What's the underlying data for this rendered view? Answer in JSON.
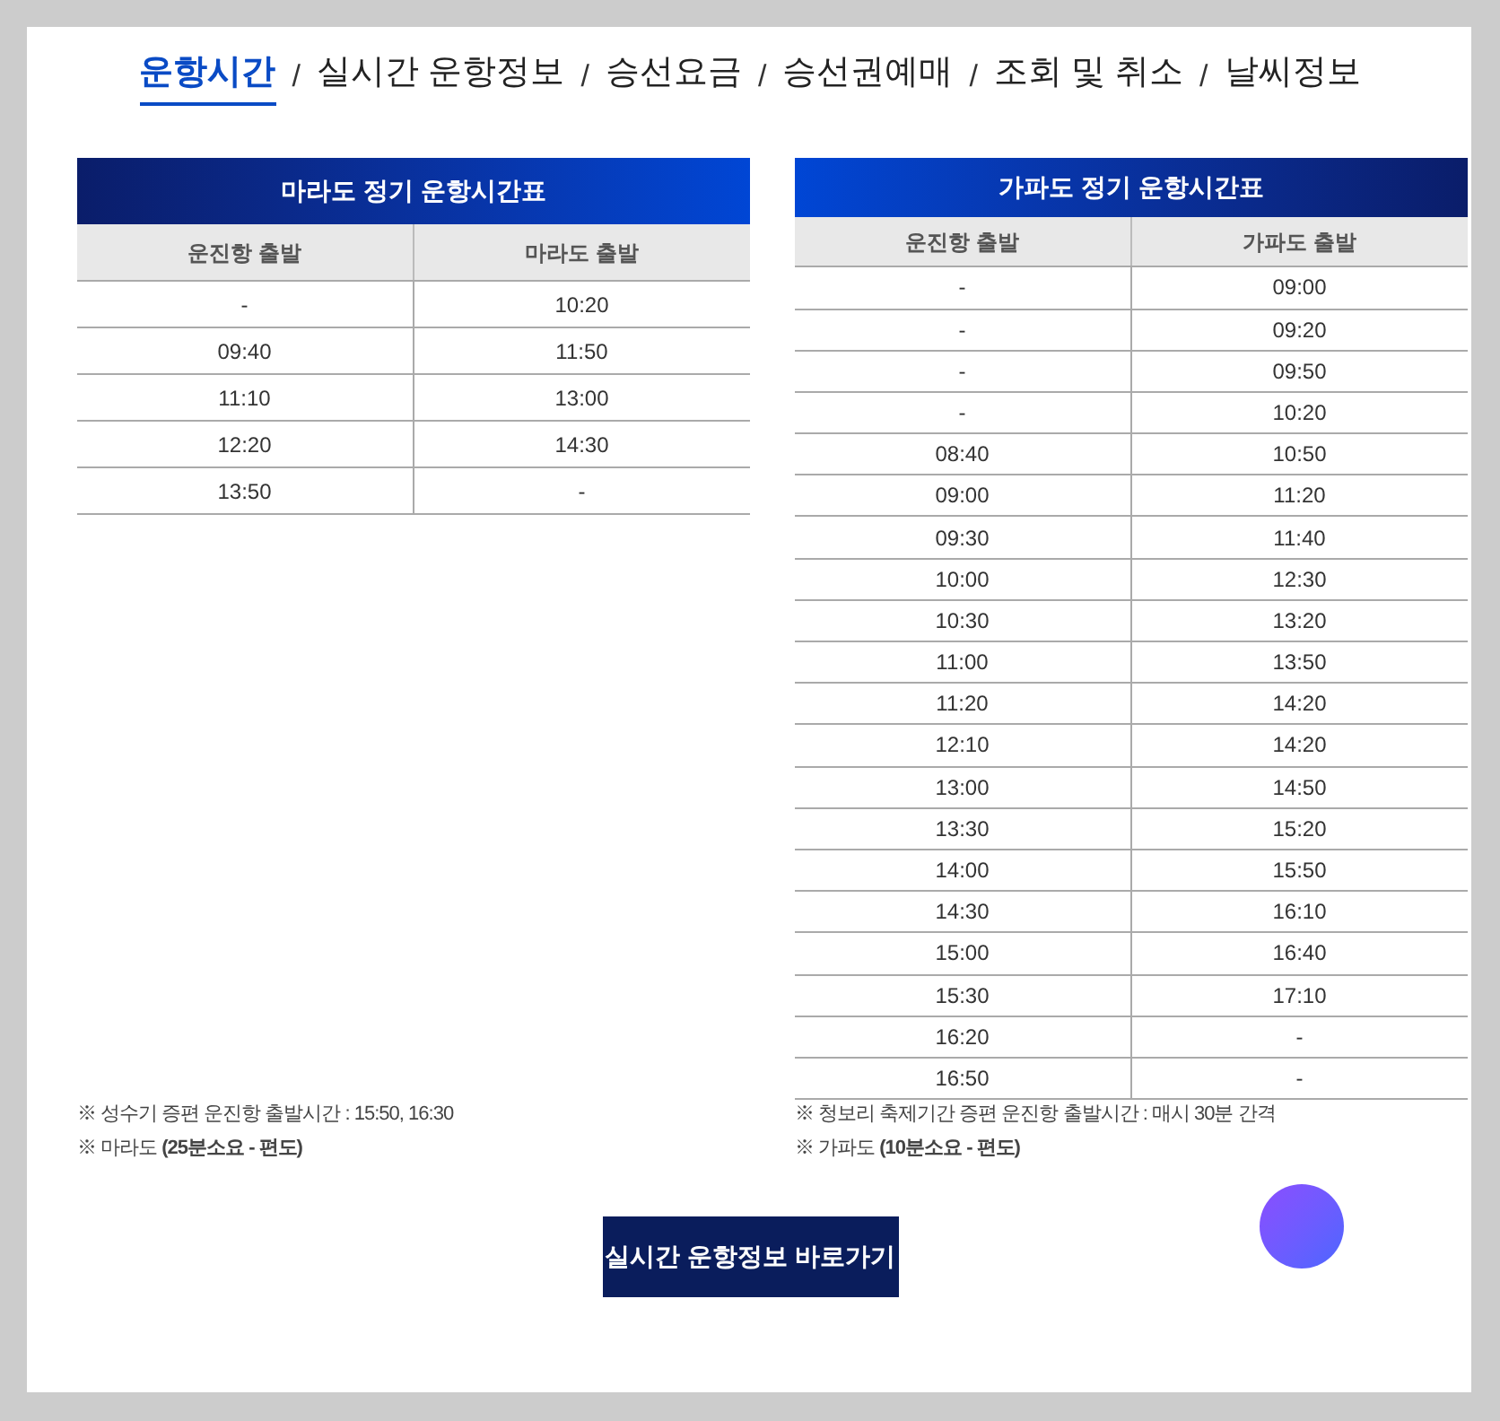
{
  "nav": [
    {
      "label": "운항시간",
      "selected": true
    },
    {
      "label": "실시간 운항정보",
      "selected": false
    },
    {
      "label": "승선요금",
      "selected": false
    },
    {
      "label": "승선권예매",
      "selected": false
    },
    {
      "label": "조회 및 취소",
      "selected": false
    },
    {
      "label": "날씨정보",
      "selected": false
    }
  ],
  "nav_separator": "/",
  "tables": [
    {
      "title": "마라도 정기 운항시간표",
      "columns": [
        "운진항 출발",
        "마라도 출발"
      ],
      "rows": [
        [
          "-",
          "10:20"
        ],
        [
          "09:40",
          "11:50"
        ],
        [
          "11:10",
          "13:00"
        ],
        [
          "12:20",
          "14:30"
        ],
        [
          "13:50",
          "-"
        ]
      ],
      "notes": [
        "※ 성수기 증편 운진항 출발시간 : 15:50, 16:30",
        "※ 마라도 **(25분소요 - 편도)**"
      ]
    },
    {
      "title": "가파도 정기 운항시간표",
      "columns": [
        "운진항 출발",
        "가파도 출발"
      ],
      "rows": [
        [
          "-",
          "09:00"
        ],
        [
          "-",
          "09:20"
        ],
        [
          "-",
          "09:50"
        ],
        [
          "-",
          "10:20"
        ],
        [
          "08:40",
          "10:50"
        ],
        [
          "09:00",
          "11:20"
        ],
        [
          "09:30",
          "11:40"
        ],
        [
          "10:00",
          "12:30"
        ],
        [
          "10:30",
          "13:20"
        ],
        [
          "11:00",
          "13:50"
        ],
        [
          "11:20",
          "14:20"
        ],
        [
          "12:10",
          "14:20"
        ],
        [
          "13:00",
          "14:50"
        ],
        [
          "13:30",
          "15:20"
        ],
        [
          "14:00",
          "15:50"
        ],
        [
          "14:30",
          "16:10"
        ],
        [
          "15:00",
          "16:40"
        ],
        [
          "15:30",
          "17:10"
        ],
        [
          "16:20",
          "-"
        ],
        [
          "16:50",
          "-"
        ]
      ],
      "notes": [
        "※ 청보리 축제기간 증편 운진항 출발시간 : 매시 30분 간격",
        "※ 가파도 **(10분소요 - 편도)**"
      ]
    }
  ],
  "button": "실시간 운항정보 바로가기"
}
